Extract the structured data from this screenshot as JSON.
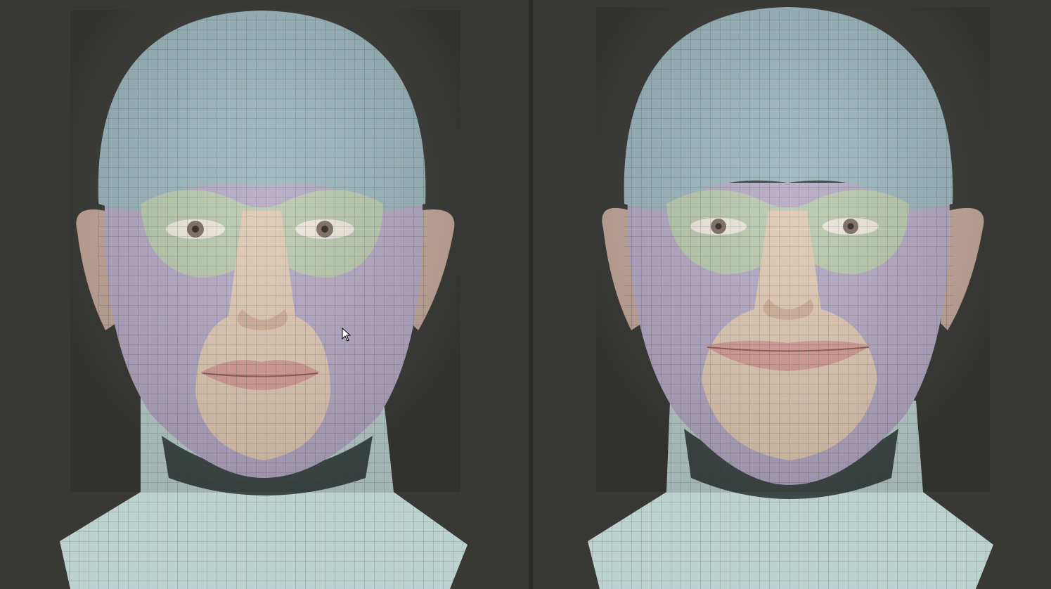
{
  "viewports": [
    {
      "id": "left",
      "expression": "neutral"
    },
    {
      "id": "right",
      "expression": "smile"
    }
  ],
  "colors": {
    "background": "#383835",
    "splitter": "#2a2a28",
    "scalp": "#9ab6bd",
    "neck": "#bcd2d0",
    "cheek": "#b4a8c4",
    "eye_region": "#b8c8ac",
    "nose_mouth": "#e0c8b2",
    "ear": "#c4a89a",
    "lips": "#d49c94",
    "iris": "#7a6a60",
    "wire": "#3a3a38"
  },
  "cursor": {
    "icon": "arrow-pointer-icon"
  }
}
